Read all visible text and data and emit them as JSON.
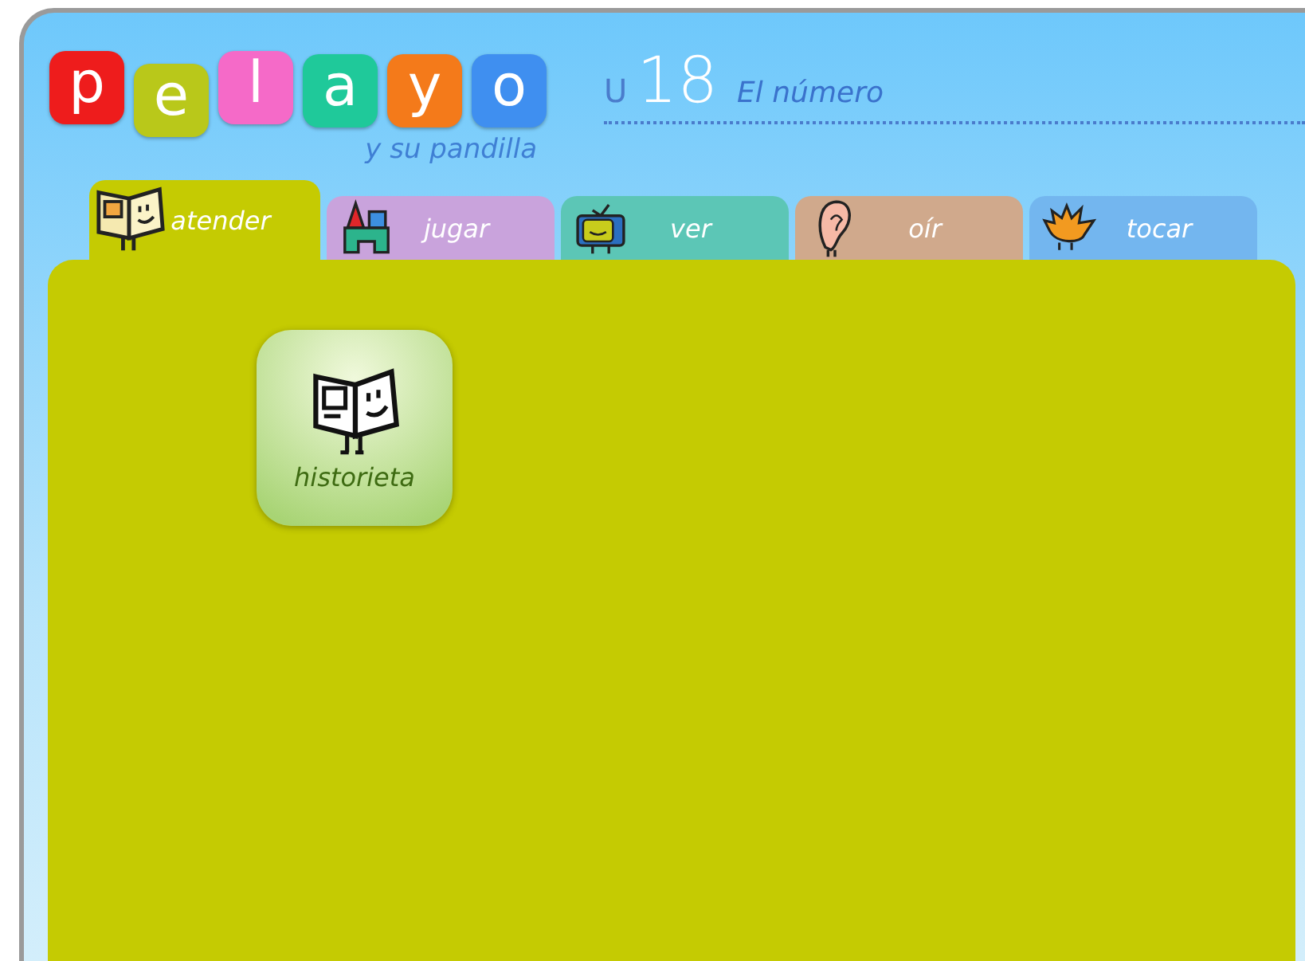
{
  "logo": {
    "letters": [
      {
        "char": "p",
        "color": "#ee1c1c"
      },
      {
        "char": "e",
        "color": "#b9c81a"
      },
      {
        "char": "l",
        "color": "#f56ac8"
      },
      {
        "char": "a",
        "color": "#1fc99a"
      },
      {
        "char": "y",
        "color": "#f47a1a"
      },
      {
        "char": "o",
        "color": "#3f8ff0"
      }
    ],
    "subtitle": "y su pandilla"
  },
  "unit": {
    "prefix": "U",
    "number": "18",
    "title": "El número"
  },
  "tabs": [
    {
      "label": "atender",
      "kind": "book",
      "color": "#c5cb02",
      "selected": true
    },
    {
      "label": "jugar",
      "kind": "blocks",
      "color": "#c9a3dc",
      "selected": false
    },
    {
      "label": "ver",
      "kind": "tv",
      "color": "#5cc6b6",
      "selected": false
    },
    {
      "label": "oír",
      "kind": "ear",
      "color": "#d0a98c",
      "selected": false
    },
    {
      "label": "tocar",
      "kind": "hand",
      "color": "#73b6ef",
      "selected": false
    }
  ],
  "items": [
    {
      "label": "historieta"
    }
  ]
}
